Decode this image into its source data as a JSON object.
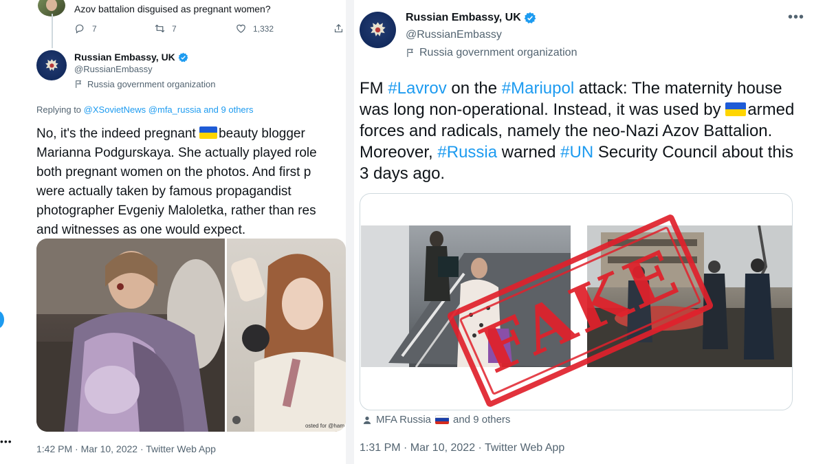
{
  "left_tweet": {
    "previous_reply_text": "Azov battalion disguised as pregnant women?",
    "actions": {
      "replies": "7",
      "retweets": "7",
      "likes": "1,332"
    },
    "author": {
      "name": "Russian Embassy, UK",
      "handle": "@RussianEmbassy",
      "label": "Russia government organization"
    },
    "replying": {
      "prefix": "Replying to",
      "users": "@XSovietNews @mfa_russia",
      "others": "and 9 others"
    },
    "body_lines": [
      {
        "before": "No, it's the indeed pregnant ",
        "after": "beauty blogger"
      },
      {
        "text": "Marianna Podgurskaya. She actually played role"
      },
      {
        "text": "both pregnant women on the photos. And first p"
      },
      {
        "text": "were actually taken by famous propagandist"
      },
      {
        "text": "photographer Evgeniy Maloletka, rather than res"
      },
      {
        "text": "and witnesses as one would expect."
      }
    ],
    "photo_watermark": "osted for @ham",
    "timestamp": "1:42 PM · Mar 10, 2022 · Twitter Web App"
  },
  "right_tweet": {
    "author": {
      "name": "Russian Embassy, UK",
      "handle": "@RussianEmbassy",
      "label": "Russia government organization"
    },
    "body": {
      "p1": "FM ",
      "h1": "#Lavrov",
      "p2": " on the ",
      "h2": "#Mariupol",
      "p3": " attack: The maternity house was long non-operational. Instead, it was used by ",
      "p4": "armed forces and radicals, namely the neo-Nazi Azov Battalion. Moreover, ",
      "h3": "#Russia",
      "p5": " warned ",
      "h4": "#UN",
      "p6": " Security Council about this 3 days ago."
    },
    "stamp_text": "FAKE",
    "tagged": {
      "name": "MFA Russia",
      "others": "and 9 others"
    },
    "timestamp": "1:31 PM · Mar 10, 2022 · Twitter Web App"
  },
  "colors": {
    "link": "#1d9bf0",
    "secondary_text": "#536471",
    "stamp": "#e0212b",
    "verified": "#1d9bf0"
  },
  "icons": [
    "reply-icon",
    "retweet-icon",
    "like-icon",
    "share-icon",
    "verified-badge-icon",
    "flag-label-icon",
    "more-icon",
    "person-tag-icon"
  ]
}
